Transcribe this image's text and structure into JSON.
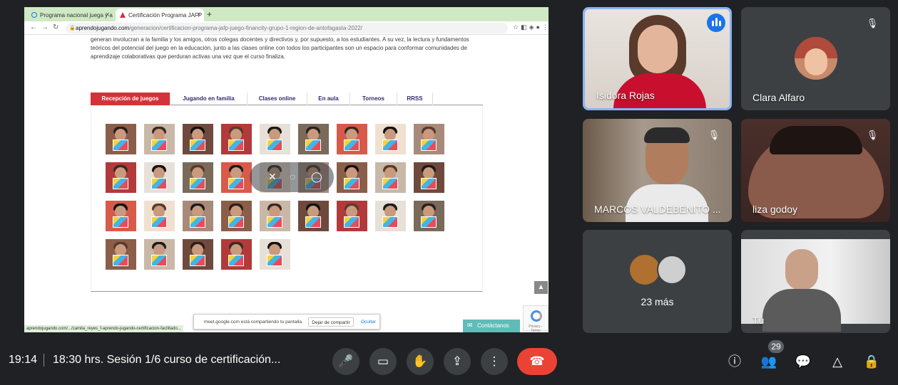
{
  "browser": {
    "tabs": [
      {
        "label": "Programa nacional juega y apr..."
      },
      {
        "label": "Certificación Programa JAFP ..."
      }
    ],
    "new_tab": "+",
    "url_domain": "aprendojugando.com",
    "url_path": "/generacion/certificacion-programa-jafp-juego-financity-grupo-1-region-de-antofagasta-2022/",
    "status_url": "aprendojugando.com/.../camila_reyes_f-aprendo-jugando-certificacion-facilitado...",
    "accent": "#cfe9c4"
  },
  "website": {
    "paragraph": "generan involucran a la familia y los amigos, otros colegas docentes y directivos y, por supuesto, a los estudiantes. A su vez, la lectura y fundamentos teóricos del potencial del juego en la educación, junto a las clases online con todos los participantes son un espacio para conformar comunidades de aprendizaje colaborativas que perduran activas una vez que el curso finaliza.",
    "tabs": [
      "Recepción de juegos",
      "Jugando en familia",
      "Clases online",
      "En aula",
      "Torneos",
      "RRSS"
    ],
    "active_tab_color": "#d33338",
    "gallery_rows": [
      9,
      9,
      9,
      5
    ],
    "scroll_top_icon": "chevron-up-icon",
    "contact_label": "Contáctanos",
    "recaptcha_text": "Privacy - Terms"
  },
  "share_bar": {
    "message": "meet.google.com está compartiendo tu pantalla.",
    "stop_label": "Dejar de compartir",
    "hide_label": "Ocultar"
  },
  "participants": [
    {
      "name": "Isidora Rojas",
      "speaking": true,
      "muted": false
    },
    {
      "name": "Clara Alfaro",
      "speaking": false,
      "muted": true
    },
    {
      "name": "MARCOS VALDEBENITO ...",
      "speaking": false,
      "muted": true
    },
    {
      "name": "liza godoy",
      "speaking": false,
      "muted": true
    },
    {
      "name": "23 más",
      "speaking": false,
      "muted": false
    },
    {
      "name": "Tú",
      "speaking": false,
      "muted": false
    }
  ],
  "meeting": {
    "time": "19:14",
    "title": "18:30 hrs. Sesión 1/6 curso de certificación...",
    "participant_count": "29",
    "end_color": "#ea4335"
  }
}
